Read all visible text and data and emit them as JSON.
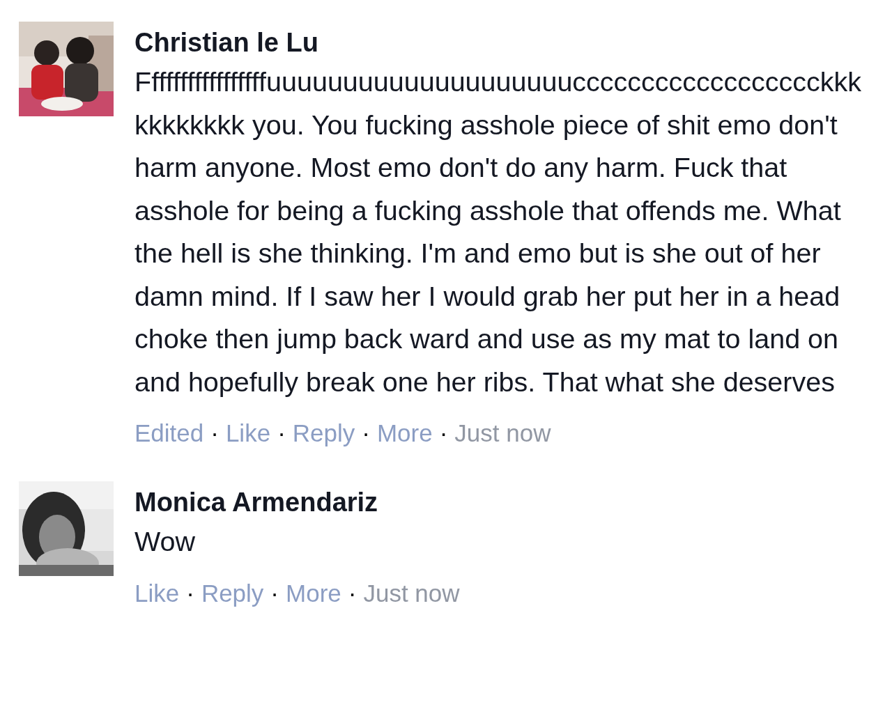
{
  "comments": [
    {
      "author": "Christian le Lu",
      "body": "Fffffffffffffffffuuuuuuuuuuuuuuuuuuuucccccccccccccccccckkkkkkkkkkk you. You fucking asshole piece of shit emo don't harm anyone. Most emo don't do any harm. Fuck that asshole for being a fucking asshole that offends me. What the hell is she thinking. I'm and emo but is she out of her damn mind. If I saw her I would grab her put her in a head choke then jump back ward and use as my mat to land on and hopefully break one her ribs. That what she deserves",
      "footer": [
        {
          "kind": "status",
          "text": "Edited"
        },
        {
          "kind": "separator",
          "text": "·"
        },
        {
          "kind": "link",
          "text": "Like"
        },
        {
          "kind": "separator",
          "text": "·"
        },
        {
          "kind": "link",
          "text": "Reply"
        },
        {
          "kind": "separator",
          "text": "·"
        },
        {
          "kind": "link",
          "text": "More"
        },
        {
          "kind": "separator",
          "text": "·"
        },
        {
          "kind": "time",
          "text": "Just now"
        }
      ]
    },
    {
      "author": "Monica Armendariz",
      "body": "Wow",
      "footer": [
        {
          "kind": "link",
          "text": "Like"
        },
        {
          "kind": "separator",
          "text": "·"
        },
        {
          "kind": "link",
          "text": "Reply"
        },
        {
          "kind": "separator",
          "text": "·"
        },
        {
          "kind": "link",
          "text": "More"
        },
        {
          "kind": "separator",
          "text": "·"
        },
        {
          "kind": "time",
          "text": "Just now"
        }
      ]
    }
  ]
}
